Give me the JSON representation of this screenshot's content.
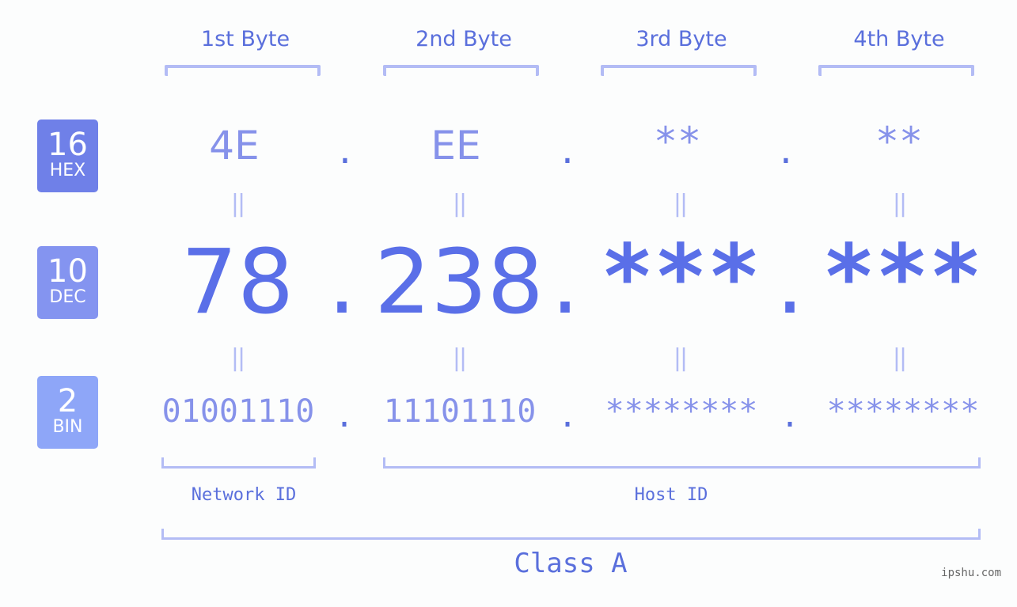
{
  "byte_headers": [
    "1st Byte",
    "2nd Byte",
    "3rd Byte",
    "4th Byte"
  ],
  "badges": [
    {
      "number": "16",
      "label": "HEX",
      "color": "#6f80e8"
    },
    {
      "number": "10",
      "label": "DEC",
      "color": "#8494f0"
    },
    {
      "number": "2",
      "label": "BIN",
      "color": "#8ea6f8"
    }
  ],
  "hex": [
    "4E",
    "EE",
    "**",
    "**"
  ],
  "dec": [
    "78",
    "238",
    "***",
    "***"
  ],
  "bin": [
    "01001110",
    "11101110",
    "********",
    "********"
  ],
  "separator": ".",
  "equals": "||",
  "network_id_label": "Network ID",
  "host_id_label": "Host ID",
  "class_label": "Class A",
  "watermark": "ipshu.com",
  "colors": {
    "primary": "#5a6fe8",
    "secondary": "#8692ea",
    "bracket": "#b3bcf5"
  }
}
